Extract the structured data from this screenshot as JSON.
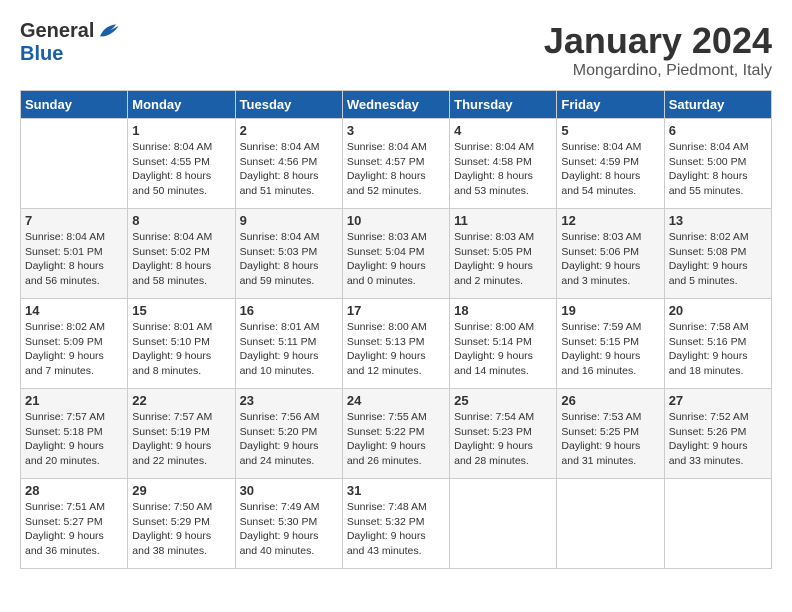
{
  "header": {
    "logo_general": "General",
    "logo_blue": "Blue",
    "month_title": "January 2024",
    "location": "Mongardino, Piedmont, Italy"
  },
  "weekdays": [
    "Sunday",
    "Monday",
    "Tuesday",
    "Wednesday",
    "Thursday",
    "Friday",
    "Saturday"
  ],
  "weeks": [
    [
      {
        "day": "",
        "sunrise": "",
        "sunset": "",
        "daylight": ""
      },
      {
        "day": "1",
        "sunrise": "Sunrise: 8:04 AM",
        "sunset": "Sunset: 4:55 PM",
        "daylight": "Daylight: 8 hours and 50 minutes."
      },
      {
        "day": "2",
        "sunrise": "Sunrise: 8:04 AM",
        "sunset": "Sunset: 4:56 PM",
        "daylight": "Daylight: 8 hours and 51 minutes."
      },
      {
        "day": "3",
        "sunrise": "Sunrise: 8:04 AM",
        "sunset": "Sunset: 4:57 PM",
        "daylight": "Daylight: 8 hours and 52 minutes."
      },
      {
        "day": "4",
        "sunrise": "Sunrise: 8:04 AM",
        "sunset": "Sunset: 4:58 PM",
        "daylight": "Daylight: 8 hours and 53 minutes."
      },
      {
        "day": "5",
        "sunrise": "Sunrise: 8:04 AM",
        "sunset": "Sunset: 4:59 PM",
        "daylight": "Daylight: 8 hours and 54 minutes."
      },
      {
        "day": "6",
        "sunrise": "Sunrise: 8:04 AM",
        "sunset": "Sunset: 5:00 PM",
        "daylight": "Daylight: 8 hours and 55 minutes."
      }
    ],
    [
      {
        "day": "7",
        "sunrise": "Sunrise: 8:04 AM",
        "sunset": "Sunset: 5:01 PM",
        "daylight": "Daylight: 8 hours and 56 minutes."
      },
      {
        "day": "8",
        "sunrise": "Sunrise: 8:04 AM",
        "sunset": "Sunset: 5:02 PM",
        "daylight": "Daylight: 8 hours and 58 minutes."
      },
      {
        "day": "9",
        "sunrise": "Sunrise: 8:04 AM",
        "sunset": "Sunset: 5:03 PM",
        "daylight": "Daylight: 8 hours and 59 minutes."
      },
      {
        "day": "10",
        "sunrise": "Sunrise: 8:03 AM",
        "sunset": "Sunset: 5:04 PM",
        "daylight": "Daylight: 9 hours and 0 minutes."
      },
      {
        "day": "11",
        "sunrise": "Sunrise: 8:03 AM",
        "sunset": "Sunset: 5:05 PM",
        "daylight": "Daylight: 9 hours and 2 minutes."
      },
      {
        "day": "12",
        "sunrise": "Sunrise: 8:03 AM",
        "sunset": "Sunset: 5:06 PM",
        "daylight": "Daylight: 9 hours and 3 minutes."
      },
      {
        "day": "13",
        "sunrise": "Sunrise: 8:02 AM",
        "sunset": "Sunset: 5:08 PM",
        "daylight": "Daylight: 9 hours and 5 minutes."
      }
    ],
    [
      {
        "day": "14",
        "sunrise": "Sunrise: 8:02 AM",
        "sunset": "Sunset: 5:09 PM",
        "daylight": "Daylight: 9 hours and 7 minutes."
      },
      {
        "day": "15",
        "sunrise": "Sunrise: 8:01 AM",
        "sunset": "Sunset: 5:10 PM",
        "daylight": "Daylight: 9 hours and 8 minutes."
      },
      {
        "day": "16",
        "sunrise": "Sunrise: 8:01 AM",
        "sunset": "Sunset: 5:11 PM",
        "daylight": "Daylight: 9 hours and 10 minutes."
      },
      {
        "day": "17",
        "sunrise": "Sunrise: 8:00 AM",
        "sunset": "Sunset: 5:13 PM",
        "daylight": "Daylight: 9 hours and 12 minutes."
      },
      {
        "day": "18",
        "sunrise": "Sunrise: 8:00 AM",
        "sunset": "Sunset: 5:14 PM",
        "daylight": "Daylight: 9 hours and 14 minutes."
      },
      {
        "day": "19",
        "sunrise": "Sunrise: 7:59 AM",
        "sunset": "Sunset: 5:15 PM",
        "daylight": "Daylight: 9 hours and 16 minutes."
      },
      {
        "day": "20",
        "sunrise": "Sunrise: 7:58 AM",
        "sunset": "Sunset: 5:16 PM",
        "daylight": "Daylight: 9 hours and 18 minutes."
      }
    ],
    [
      {
        "day": "21",
        "sunrise": "Sunrise: 7:57 AM",
        "sunset": "Sunset: 5:18 PM",
        "daylight": "Daylight: 9 hours and 20 minutes."
      },
      {
        "day": "22",
        "sunrise": "Sunrise: 7:57 AM",
        "sunset": "Sunset: 5:19 PM",
        "daylight": "Daylight: 9 hours and 22 minutes."
      },
      {
        "day": "23",
        "sunrise": "Sunrise: 7:56 AM",
        "sunset": "Sunset: 5:20 PM",
        "daylight": "Daylight: 9 hours and 24 minutes."
      },
      {
        "day": "24",
        "sunrise": "Sunrise: 7:55 AM",
        "sunset": "Sunset: 5:22 PM",
        "daylight": "Daylight: 9 hours and 26 minutes."
      },
      {
        "day": "25",
        "sunrise": "Sunrise: 7:54 AM",
        "sunset": "Sunset: 5:23 PM",
        "daylight": "Daylight: 9 hours and 28 minutes."
      },
      {
        "day": "26",
        "sunrise": "Sunrise: 7:53 AM",
        "sunset": "Sunset: 5:25 PM",
        "daylight": "Daylight: 9 hours and 31 minutes."
      },
      {
        "day": "27",
        "sunrise": "Sunrise: 7:52 AM",
        "sunset": "Sunset: 5:26 PM",
        "daylight": "Daylight: 9 hours and 33 minutes."
      }
    ],
    [
      {
        "day": "28",
        "sunrise": "Sunrise: 7:51 AM",
        "sunset": "Sunset: 5:27 PM",
        "daylight": "Daylight: 9 hours and 36 minutes."
      },
      {
        "day": "29",
        "sunrise": "Sunrise: 7:50 AM",
        "sunset": "Sunset: 5:29 PM",
        "daylight": "Daylight: 9 hours and 38 minutes."
      },
      {
        "day": "30",
        "sunrise": "Sunrise: 7:49 AM",
        "sunset": "Sunset: 5:30 PM",
        "daylight": "Daylight: 9 hours and 40 minutes."
      },
      {
        "day": "31",
        "sunrise": "Sunrise: 7:48 AM",
        "sunset": "Sunset: 5:32 PM",
        "daylight": "Daylight: 9 hours and 43 minutes."
      },
      {
        "day": "",
        "sunrise": "",
        "sunset": "",
        "daylight": ""
      },
      {
        "day": "",
        "sunrise": "",
        "sunset": "",
        "daylight": ""
      },
      {
        "day": "",
        "sunrise": "",
        "sunset": "",
        "daylight": ""
      }
    ]
  ]
}
